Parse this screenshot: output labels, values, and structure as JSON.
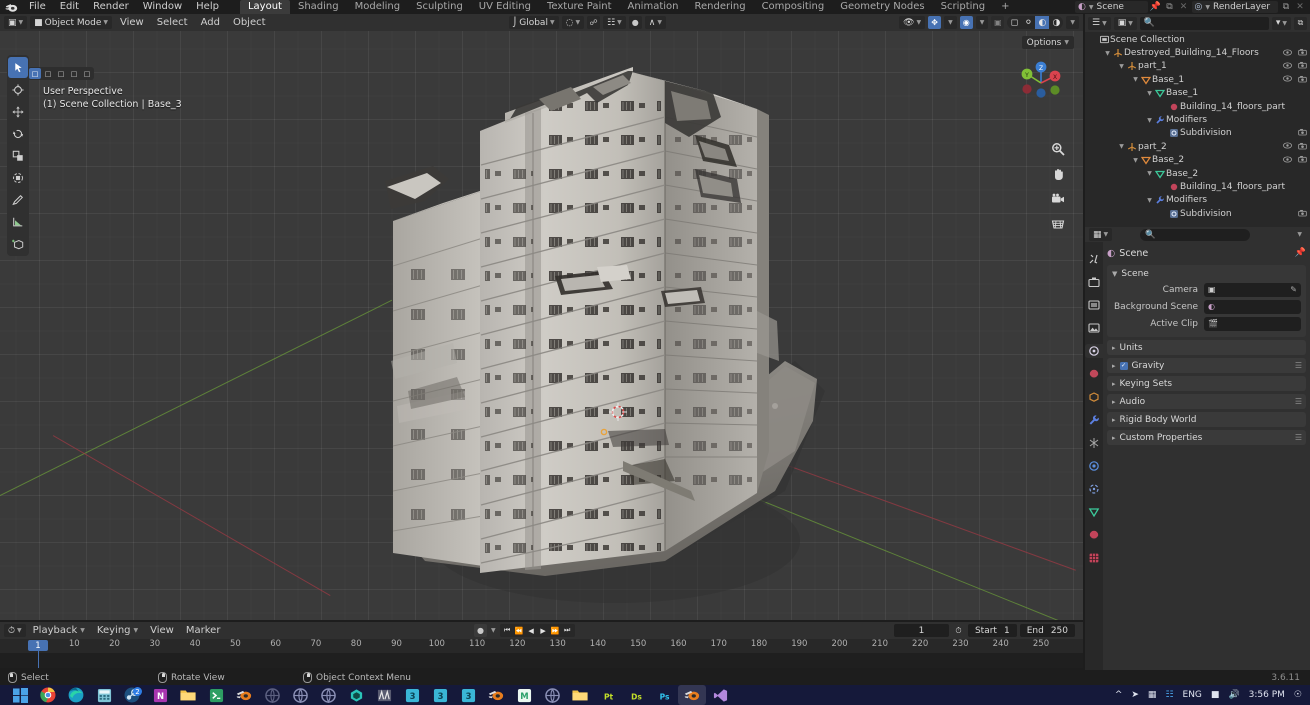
{
  "app": {
    "name": "Blender",
    "version": "3.6.11"
  },
  "topbar": {
    "menus": [
      "File",
      "Edit",
      "Render",
      "Window",
      "Help"
    ],
    "workspaces": [
      "Layout",
      "Shading",
      "Modeling",
      "Sculpting",
      "UV Editing",
      "Texture Paint",
      "Animation",
      "Rendering",
      "Compositing",
      "Geometry Nodes",
      "Scripting"
    ],
    "add_workspace_label": "+",
    "active_workspace": "Layout",
    "scene_name": "Scene",
    "view_layer_name": "RenderLayer",
    "scene_icon": "scene-icon",
    "view_layer_icon": "view-layer-icon",
    "pin_icon": "pin-icon",
    "copy_icon": "copy-icon",
    "close_icon": "close-icon"
  },
  "viewport_header": {
    "editor_type_icon": "editor-type-icon",
    "mode": "Object Mode",
    "mode_icon": "object-mode-icon",
    "menus": [
      "View",
      "Select",
      "Add",
      "Object"
    ],
    "transform_orientation": "Global",
    "orientation_icon": "orientation-icon",
    "snap_icon": "magnet-icon",
    "proportional_icon": "proportional-edit-icon",
    "proportional_falloff_icon": "falloff-curve-icon",
    "pivot_icon": "pivot-point-icon",
    "visibility_icon": "visibility-icon",
    "gizmo_icon": "gizmo-icon",
    "overlays_icon": "overlays-icon",
    "xray_icon": "xray-icon",
    "shading_modes": [
      "wireframe",
      "solid",
      "material-preview",
      "rendered"
    ],
    "active_shading_mode": "material-preview"
  },
  "viewport": {
    "tools": [
      {
        "name": "tweak-tool",
        "active": true
      },
      {
        "name": "cursor-tool",
        "active": false
      },
      {
        "name": "move-tool",
        "active": false
      },
      {
        "name": "rotate-tool",
        "active": false
      },
      {
        "name": "scale-tool",
        "active": false
      },
      {
        "name": "transform-tool",
        "active": false
      },
      {
        "name": "annotate-tool",
        "active": false
      },
      {
        "name": "measure-tool",
        "active": false
      },
      {
        "name": "add-cube-tool",
        "active": false
      }
    ],
    "select_modes": [
      "set",
      "extend",
      "subtract",
      "invert",
      "intersect"
    ],
    "overlay_line1": "User Perspective",
    "overlay_line2": "(1) Scene Collection | Base_3",
    "options_label": "Options",
    "gizmo_axes": [
      {
        "label": "Z",
        "color": "#3b7fd4"
      },
      {
        "label": "Y",
        "color": "#81c036"
      },
      {
        "label": "X",
        "color": "#d9434e"
      }
    ],
    "nav_buttons": [
      "zoom-icon",
      "pan-hand-icon",
      "camera-view-icon",
      "toggle-perspective-icon"
    ],
    "background_color": "#3a3a3a",
    "grid_color": "#4a4a4a",
    "axis_x_color": "#9c3a44",
    "axis_y_color": "#6a9a3a",
    "model_name": "Destroyed building ruin"
  },
  "timeline": {
    "editor_icon": "timeline-icon",
    "menus": [
      "Playback",
      "Keying",
      "View",
      "Marker"
    ],
    "record_icon": "record-icon",
    "transport": [
      "jump-to-start-icon",
      "jump-to-prev-keyframe-icon",
      "play-reverse-icon",
      "play-icon",
      "jump-to-next-keyframe-icon",
      "jump-to-end-icon"
    ],
    "current_frame": "1",
    "auto_key_icon": "auto-keyframe-icon",
    "start_label": "Start",
    "start_value": "1",
    "end_label": "End",
    "end_value": "250",
    "ruler_ticks": [
      "1",
      "10",
      "20",
      "30",
      "40",
      "50",
      "60",
      "70",
      "80",
      "90",
      "100",
      "110",
      "120",
      "130",
      "140",
      "150",
      "160",
      "170",
      "180",
      "190",
      "200",
      "210",
      "220",
      "230",
      "240",
      "250"
    ],
    "playhead_frame": "1"
  },
  "statusbar": {
    "items": [
      {
        "icon": "mouse-left-icon",
        "label": "Select"
      },
      {
        "icon": "mouse-middle-icon",
        "label": "Rotate View"
      },
      {
        "icon": "mouse-right-icon",
        "label": "Object Context Menu"
      }
    ],
    "version": "3.6.11"
  },
  "outliner": {
    "display_mode_icon": "outliner-display-mode-icon",
    "search_placeholder": "",
    "search_icon": "search-icon",
    "filter_icon": "filter-icon",
    "new_collection_icon": "new-collection-icon",
    "rows": [
      {
        "indent": 0,
        "disclosure": "",
        "icon": "collection-icon",
        "icon_color": "#c8c8c8",
        "label": "Scene Collection",
        "eye": false,
        "camera": false
      },
      {
        "indent": 1,
        "disclosure": "v",
        "icon": "empty-axes-icon",
        "icon_color": "#d08b3a",
        "label": "Destroyed_Building_14_Floors",
        "eye": true,
        "camera": true
      },
      {
        "indent": 2,
        "disclosure": "v",
        "icon": "empty-axes-icon",
        "icon_color": "#d08b3a",
        "label": "part_1",
        "eye": true,
        "camera": true
      },
      {
        "indent": 3,
        "disclosure": "v",
        "icon": "mesh-object-icon",
        "icon_color": "#e08a3c",
        "label": "Base_1",
        "eye": true,
        "camera": true
      },
      {
        "indent": 4,
        "disclosure": "v",
        "icon": "mesh-data-icon",
        "icon_color": "#3cc99a",
        "label": "Base_1",
        "eye": false,
        "camera": false
      },
      {
        "indent": 5,
        "disclosure": "",
        "icon": "material-icon",
        "icon_color": "#c2445a",
        "label": "Building_14_floors_part",
        "eye": false,
        "camera": false
      },
      {
        "indent": 4,
        "disclosure": "v",
        "icon": "modifier-icon",
        "icon_color": "#5b7fe0",
        "label": "Modifiers",
        "eye": false,
        "camera": false
      },
      {
        "indent": 5,
        "disclosure": "",
        "icon": "subdivision-icon",
        "icon_color": "#7fa7e8",
        "label": "Subdivision",
        "eye": false,
        "camera": true
      },
      {
        "indent": 2,
        "disclosure": "v",
        "icon": "empty-axes-icon",
        "icon_color": "#d08b3a",
        "label": "part_2",
        "eye": true,
        "camera": true
      },
      {
        "indent": 3,
        "disclosure": "v",
        "icon": "mesh-object-icon",
        "icon_color": "#e08a3c",
        "label": "Base_2",
        "eye": true,
        "camera": true
      },
      {
        "indent": 4,
        "disclosure": "v",
        "icon": "mesh-data-icon",
        "icon_color": "#3cc99a",
        "label": "Base_2",
        "eye": false,
        "camera": false
      },
      {
        "indent": 5,
        "disclosure": "",
        "icon": "material-icon",
        "icon_color": "#c2445a",
        "label": "Building_14_floors_part",
        "eye": false,
        "camera": false
      },
      {
        "indent": 4,
        "disclosure": "v",
        "icon": "modifier-icon",
        "icon_color": "#5b7fe0",
        "label": "Modifiers",
        "eye": false,
        "camera": false
      },
      {
        "indent": 5,
        "disclosure": "",
        "icon": "subdivision-icon",
        "icon_color": "#7fa7e8",
        "label": "Subdivision",
        "eye": false,
        "camera": true
      }
    ]
  },
  "properties": {
    "editor_icon": "properties-editor-icon",
    "search_placeholder": "",
    "search_icon": "search-icon",
    "breadcrumb_icon": "scene-icon",
    "breadcrumb": "Scene",
    "pin_icon": "pin-icon",
    "tabs": [
      {
        "name": "tool-tab",
        "glyph": "⚒",
        "color": "#c9c9c9",
        "active": false
      },
      {
        "name": "render-tab",
        "glyph": "⬛",
        "color": "#c9c9c9",
        "active": false
      },
      {
        "name": "output-tab",
        "glyph": "⎙",
        "color": "#c9c9c9",
        "active": false
      },
      {
        "name": "view-layer-tab",
        "glyph": "ὛC",
        "color": "#c9c9c9",
        "active": false
      },
      {
        "name": "scene-tab",
        "glyph": "◎",
        "color": "#d8d8d8",
        "active": true
      },
      {
        "name": "world-tab",
        "glyph": "●",
        "color": "#c0485a",
        "active": false
      },
      {
        "name": "object-tab",
        "glyph": "■",
        "color": "#d08b3a",
        "active": false
      },
      {
        "name": "modifier-tab",
        "glyph": "ὒ7",
        "color": "#5b7fe0",
        "active": false
      },
      {
        "name": "particles-tab",
        "glyph": "✳",
        "color": "#a8a8a8",
        "active": false
      },
      {
        "name": "physics-tab",
        "glyph": "◉",
        "color": "#5b8fe0",
        "active": false
      },
      {
        "name": "constraints-tab",
        "glyph": "⟳",
        "color": "#7f9fe0",
        "active": false
      },
      {
        "name": "data-tab",
        "glyph": "▽",
        "color": "#3cc99a",
        "active": false
      },
      {
        "name": "material-tab",
        "glyph": "●",
        "color": "#c2445a",
        "active": false
      },
      {
        "name": "texture-tab",
        "glyph": "▦",
        "color": "#c2445a",
        "active": false
      }
    ],
    "scene_panel": {
      "title": "Scene",
      "rows": [
        {
          "label": "Camera",
          "value": "",
          "icon": "camera-data-icon",
          "right_icon": "eyedropper-icon"
        },
        {
          "label": "Background Scene",
          "value": "",
          "icon": "scene-icon",
          "right_icon": ""
        },
        {
          "label": "Active Clip",
          "value": "",
          "icon": "movie-clip-icon",
          "right_icon": ""
        }
      ]
    },
    "closed_panels": [
      {
        "label": "Units",
        "checkbox": false,
        "grip": false
      },
      {
        "label": "Gravity",
        "checkbox": true,
        "grip": true
      },
      {
        "label": "Keying Sets",
        "checkbox": false,
        "grip": false
      },
      {
        "label": "Audio",
        "checkbox": false,
        "grip": true
      },
      {
        "label": "Rigid Body World",
        "checkbox": false,
        "grip": false
      },
      {
        "label": "Custom Properties",
        "checkbox": false,
        "grip": true
      }
    ]
  },
  "taskbar": {
    "start_icon": "windows-start-icon",
    "icons": [
      {
        "name": "windows-start-icon",
        "color": "#4aa3e8",
        "glyph": ""
      },
      {
        "name": "chrome-icon",
        "color": "#e94436",
        "glyph": ""
      },
      {
        "name": "edge-icon",
        "color": "#14a0c4",
        "glyph": ""
      },
      {
        "name": "calculator-icon",
        "color": "#7fc4d6",
        "glyph": ""
      },
      {
        "name": "steam-icon",
        "color": "#2a6fa8",
        "glyph": "",
        "badge": "2"
      },
      {
        "name": "onenote-icon",
        "color": "#a836b0",
        "glyph": "N"
      },
      {
        "name": "file-explorer-icon",
        "color": "#f3c44a",
        "glyph": ""
      },
      {
        "name": "terminal-icon",
        "color": "#2d9e63",
        "glyph": ">"
      },
      {
        "name": "blender-icon",
        "color": "#e87d1e",
        "glyph": ""
      },
      {
        "name": "browser-icon-1",
        "color": "#5c6080",
        "glyph": ""
      },
      {
        "name": "browser-icon-2",
        "color": "#8a8fb5",
        "glyph": ""
      },
      {
        "name": "browser-icon-3",
        "color": "#8a8fb5",
        "glyph": ""
      },
      {
        "name": "unity-icon",
        "color": "#2ac4b8",
        "glyph": ""
      },
      {
        "name": "substance-icon",
        "color": "#c9c9c9",
        "glyph": ""
      },
      {
        "name": "max3ds-icon-1",
        "color": "#3ab6d6",
        "glyph": "3"
      },
      {
        "name": "max3ds-icon-2",
        "color": "#3ab6d6",
        "glyph": "3"
      },
      {
        "name": "max3ds-icon-3",
        "color": "#3ab6d6",
        "glyph": "3"
      },
      {
        "name": "blender-icon-2",
        "color": "#e87d1e",
        "glyph": ""
      },
      {
        "name": "marmoset-icon",
        "color": "#3cc47c",
        "glyph": "M"
      },
      {
        "name": "browser-icon-4",
        "color": "#8a8fb5",
        "glyph": ""
      },
      {
        "name": "folder-icon",
        "color": "#f3c44a",
        "glyph": ""
      },
      {
        "name": "painter-icon",
        "color": "#c3e029",
        "glyph": "Pt"
      },
      {
        "name": "designer-icon",
        "color": "#c3e029",
        "glyph": "Ds"
      },
      {
        "name": "photoshop-icon",
        "color": "#31c5f0",
        "glyph": "Ps"
      },
      {
        "name": "blender-icon-3",
        "color": "#e87d1e",
        "glyph": "",
        "active": true
      },
      {
        "name": "visualstudio-icon",
        "color": "#b388dd",
        "glyph": ""
      }
    ],
    "tray": {
      "expand_icon": "chevron-up-icon",
      "telegram_icon": "telegram-icon",
      "display_icon": "display-icon",
      "network_icon": "network-icon",
      "language": "ENG",
      "battery_icon": "battery-icon",
      "volume_icon": "volume-icon",
      "clock": "3:56 PM",
      "notification_icon": "notifications-icon"
    }
  }
}
